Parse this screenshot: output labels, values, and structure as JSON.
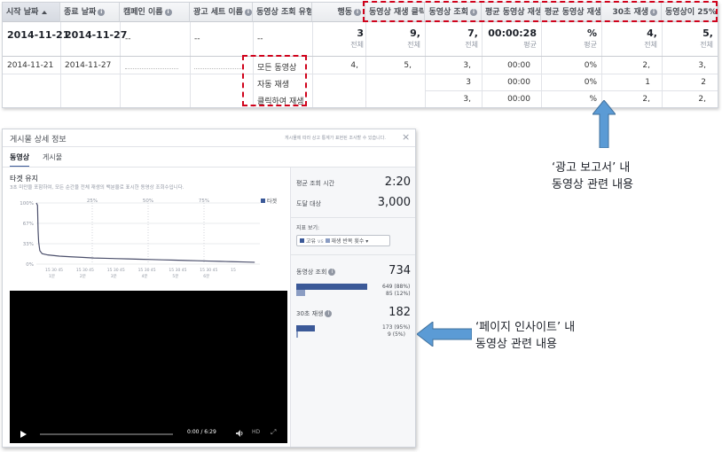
{
  "report": {
    "headers": {
      "start_date": "시작 날짜",
      "end_date": "종료 날짜",
      "campaign_name": "캠페인 이름",
      "adset_name": "광고 세트 이름",
      "view_type": "동영상 조회 유형",
      "actions": "행동",
      "play_clicks": "동영상 재생 클릭",
      "video_views": "동영상 조회",
      "avg_view_time": "평균 동영상 재생",
      "avg_view_pct": "평균 동영상 재생",
      "views_30s": "30초 재생",
      "views_25pct": "동영상이 25%까"
    },
    "total_row": {
      "start_date": "2014-11-21",
      "end_date": "2014-11-27",
      "campaign": "--",
      "adset": "--",
      "view_type": "--",
      "actions": "3",
      "actions_sub": "전체",
      "play_clicks": "9,",
      "play_clicks_sub": "전체",
      "video_views": "7,",
      "video_views_sub": "전체",
      "avg_view_time": "00:00:28",
      "avg_view_time_sub": "평균",
      "avg_view_pct": "%",
      "avg_view_pct_sub": "평균",
      "views_30s": "4,",
      "views_30s_sub": "전체",
      "views_25pct": "5,",
      "views_25pct_sub": "전체"
    },
    "rows": [
      {
        "start_date": "2014-11-21",
        "end_date": "2014-11-27",
        "campaign": "",
        "adset": "",
        "view_type": "모든 동영상",
        "actions": "4,",
        "play_clicks": "5,",
        "video_views": "3,",
        "avg_view_time": "00:00",
        "avg_view_pct": "0%",
        "views_30s": "2,",
        "views_25pct": "3,"
      },
      {
        "start_date": "",
        "end_date": "",
        "campaign": "",
        "adset": "",
        "view_type": "자동 재생",
        "actions": "",
        "play_clicks": "",
        "video_views": "3",
        "avg_view_time": "00:00",
        "avg_view_pct": "0%",
        "views_30s": "1",
        "views_25pct": "2"
      },
      {
        "start_date": "",
        "end_date": "",
        "campaign": "",
        "adset": "",
        "view_type": "클릭하여 재생",
        "actions": "",
        "play_clicks": "",
        "video_views": "3,",
        "avg_view_time": "00:00",
        "avg_view_pct": "%",
        "views_30s": "2,",
        "views_25pct": "2,"
      }
    ]
  },
  "callouts": {
    "report_line1": "‘광고 보고서’ 내",
    "report_line2": "동영상 관련 내용",
    "insights_line1": "‘페이지 인사이트’ 내",
    "insights_line2": "동영상 관련 내용"
  },
  "insights": {
    "title": "게시물 상세 정보",
    "header_note": "게시물에 따라 상고 통계가 표현된 조사할 수 있습니다.",
    "close": "×",
    "tabs": [
      "동영상",
      "게시물"
    ],
    "retention_title": "타겟 유지",
    "retention_desc": "3초 미만을 포함하여, 모든 순간을 전체 재생의 백분율로 표시한 동영상 조회수입니다.",
    "legend_label": "타겟",
    "chart_data": {
      "type": "line",
      "title": "타겟 유지",
      "ylabel": "",
      "y_ticks": [
        "100%",
        "67%",
        "33%",
        "0%"
      ],
      "top_markers": [
        "25%",
        "50%",
        "75%"
      ],
      "x_tick_labels": [
        "15 30 45",
        "15 30 45",
        "15 30 45",
        "15 30 45",
        "15 30 45",
        "15 30 45",
        "15"
      ],
      "x_minute_labels": [
        "1분",
        "2분",
        "3분",
        "4분",
        "5분",
        "6분"
      ],
      "ylim": [
        0,
        100
      ],
      "series": [
        {
          "name": "타겟",
          "x": [
            0,
            2,
            3,
            4,
            6,
            10,
            20,
            40,
            60,
            80,
            100,
            120,
            140,
            160,
            180,
            200,
            220,
            240,
            260,
            280,
            300,
            320,
            340,
            360,
            380
          ],
          "y": [
            100,
            96,
            55,
            36,
            22,
            17,
            15,
            13,
            12,
            11,
            10,
            9.5,
            9,
            8.5,
            8,
            7.5,
            7,
            6.5,
            6,
            5.5,
            5,
            4.5,
            4,
            3.5,
            3
          ]
        }
      ]
    },
    "video": {
      "time": "0:00 / 6:29",
      "hd": "HD"
    },
    "stats": {
      "avg_view_time_label": "평균 조회 시간",
      "avg_view_time_value": "2:20",
      "reach_label": "도달 대상",
      "reach_value": "3,000",
      "view_option_label": "지표 보기:",
      "dropdown_a": "고유",
      "dropdown_vs": "vs",
      "dropdown_b": "재생 반복 횟수",
      "video_views_label": "동영상 조회",
      "video_views_value": "734",
      "vv_unique": "649",
      "vv_unique_pct": "(88%)",
      "vv_repeat": "85",
      "vv_repeat_pct": "(12%)",
      "views30_label": "30초 재생",
      "views30_value": "182",
      "v30_unique": "173",
      "v30_unique_pct": "(95%)",
      "v30_repeat": "9",
      "v30_repeat_pct": "(5%)"
    }
  },
  "colors": {
    "accent_blue": "#3b5998",
    "light_blue": "#8b9dc3",
    "highlight_red": "#d0021b",
    "arrow_blue": "#5b9bd5"
  }
}
